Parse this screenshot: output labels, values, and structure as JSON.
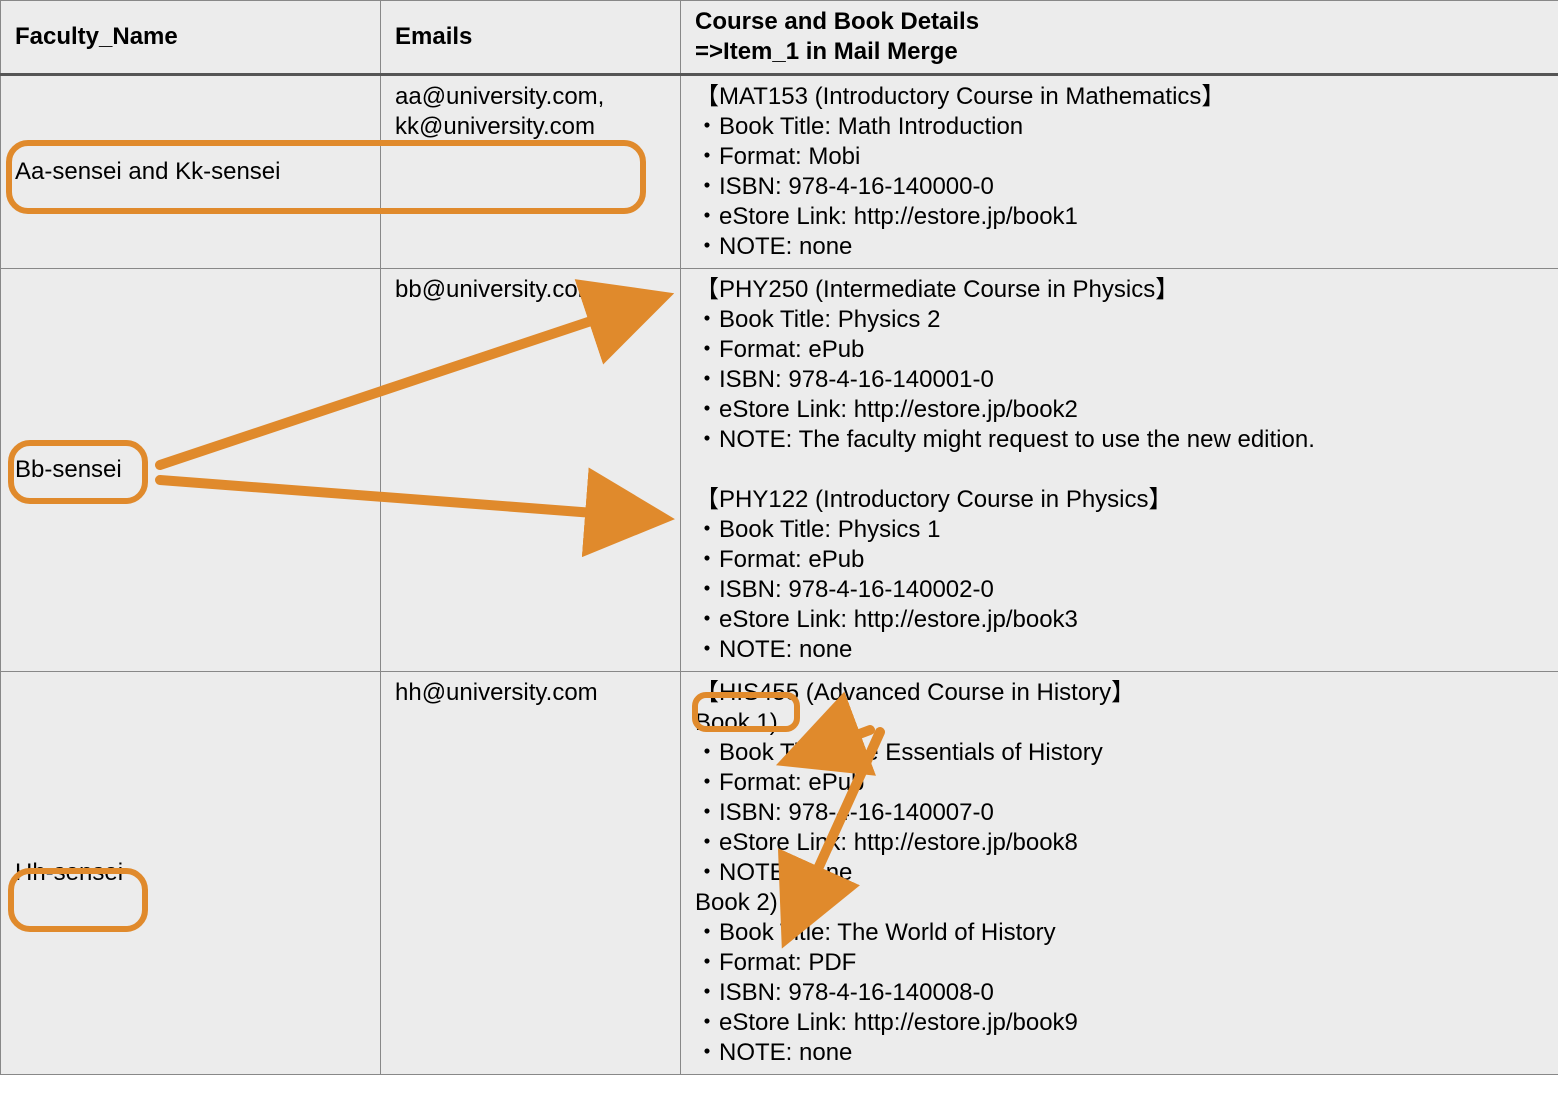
{
  "headers": {
    "col1": "Faculty_Name",
    "col2": "Emails",
    "col3_line1": "Course and Book Details",
    "col3_line2": "=>Item_1 in Mail Merge"
  },
  "rows": [
    {
      "faculty": "Aa-sensei and Kk-sensei",
      "emails": "aa@university.com,\nkk@university.com",
      "details": "【MAT153 (Introductory Course in Mathematics】\n・Book Title: Math Introduction\n・Format: Mobi\n・ISBN: 978-4-16-140000-0\n・eStore Link: http://estore.jp/book1\n・NOTE: none"
    },
    {
      "faculty": "Bb-sensei",
      "emails": "bb@university.com",
      "details": "【PHY250 (Intermediate Course in Physics】\n・Book Title: Physics 2\n・Format: ePub\n・ISBN: 978-4-16-140001-0\n・eStore Link: http://estore.jp/book2\n・NOTE: The faculty might request to use the new edition.\n\n【PHY122 (Introductory Course in Physics】\n・Book Title: Physics 1\n・Format: ePub\n・ISBN: 978-4-16-140002-0\n・eStore Link: http://estore.jp/book3\n・NOTE: none"
    },
    {
      "faculty": "Hh-sensei",
      "emails": "hh@university.com",
      "details": "【HIS455 (Advanced Course in History】\nBook 1)\n・Book Title: The Essentials of History\n・Format: ePub\n・ISBN: 978-4-16-140007-0\n・eStore Link: http://estore.jp/book8\n・NOTE: none\nBook 2)\n・Book Title: The World of History\n・Format: PDF\n・ISBN: 978-4-16-140008-0\n・eStore Link: http://estore.jp/book9\n・NOTE: none"
    }
  ],
  "annotations": {
    "highlight_color": "#e08a2c",
    "circled": [
      "Aa-sensei and Kk-sensei + emails",
      "Bb-sensei",
      "Hh-sensei",
      "HIS455"
    ],
    "arrows": [
      {
        "from": "Bb-sensei",
        "to": "PHY250 block"
      },
      {
        "from": "Bb-sensei",
        "to": "PHY122 block"
      },
      {
        "from": "HIS455",
        "to": "Book 1)"
      },
      {
        "from": "HIS455",
        "to": "Book 2)"
      }
    ]
  }
}
